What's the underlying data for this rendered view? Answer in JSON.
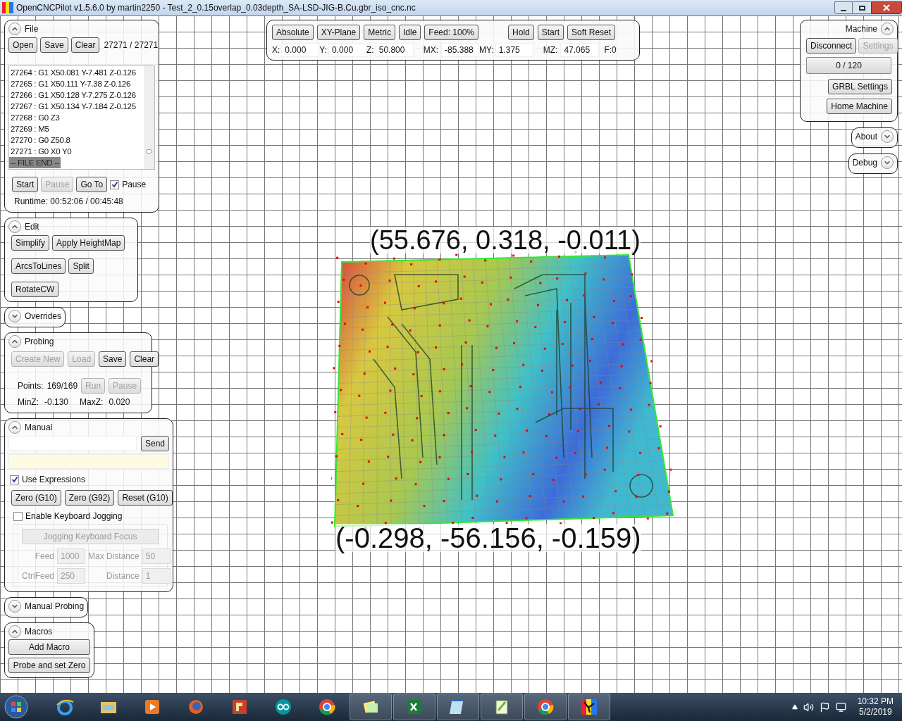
{
  "window": {
    "title": "OpenCNCPilot v1.5.6.0 by martin2250 - Test_2_0.15overlap_0.03depth_SA-LSD-JIG-B.Cu.gbr_iso_cnc.nc"
  },
  "file_panel": {
    "title": "File",
    "expanded": true,
    "buttons": [
      {
        "label": "Open",
        "disabled": false
      },
      {
        "label": "Save",
        "disabled": false
      },
      {
        "label": "Clear",
        "disabled": false
      }
    ],
    "progress": "27271 / 27271",
    "lines": [
      {
        "text": "27264 : G1 X50.081 Y-7.481 Z-0.126",
        "selected": false
      },
      {
        "text": "27265 : G1 X50.111 Y-7.38 Z-0.126",
        "selected": false
      },
      {
        "text": "27266 : G1 X50.128 Y-7.275 Z-0.126",
        "selected": false
      },
      {
        "text": "27267 : G1 X50.134 Y-7.184 Z-0.125",
        "selected": false
      },
      {
        "text": "27268 : G0 Z3",
        "selected": false
      },
      {
        "text": "27269 : M5",
        "selected": false
      },
      {
        "text": "27270 : G0 Z50.8",
        "selected": false
      },
      {
        "text": "27271 : G0 X0 Y0",
        "selected": false
      },
      {
        "text": "-- FILE END --",
        "selected": true
      }
    ],
    "controls": [
      {
        "kind": "button",
        "label": "Start",
        "disabled": false
      },
      {
        "kind": "button",
        "label": "Pause",
        "disabled": true
      },
      {
        "kind": "button",
        "label": "Go To",
        "disabled": false
      },
      {
        "kind": "checkbox",
        "label": "Pause",
        "checked": true
      }
    ],
    "runtime": "Runtime: 00:52:06 / 00:45:48"
  },
  "edit_panel": {
    "title": "Edit",
    "expanded": true,
    "button_rows": [
      [
        {
          "label": "Simplify",
          "disabled": false
        },
        {
          "label": "Apply HeightMap",
          "disabled": false
        }
      ],
      [
        {
          "label": "ArcsToLines",
          "disabled": false
        },
        {
          "label": "Split",
          "disabled": false
        }
      ],
      [
        {
          "label": "RotateCW",
          "disabled": false
        }
      ]
    ]
  },
  "overrides_panel": {
    "title": "Overrides",
    "expanded": false
  },
  "probing_panel": {
    "title": "Probing",
    "expanded": true,
    "buttons": [
      {
        "label": "Create New",
        "disabled": true
      },
      {
        "label": "Load",
        "disabled": true
      },
      {
        "label": "Save",
        "disabled": false
      },
      {
        "label": "Clear",
        "disabled": false
      }
    ],
    "points_label": "Points:",
    "points": "169/169",
    "run_buttons": [
      {
        "label": "Run",
        "disabled": true
      },
      {
        "label": "Pause",
        "disabled": true
      }
    ],
    "minz_label": "MinZ:",
    "minz": "-0.130",
    "maxz_label": "MaxZ:",
    "maxz": "0.020"
  },
  "manual_panel": {
    "title": "Manual",
    "expanded": true,
    "send": "Send",
    "use_expressions": {
      "label": "Use Expressions",
      "checked": true
    },
    "zero_buttons": [
      {
        "label": "Zero (G10)",
        "disabled": false
      },
      {
        "label": "Zero (G92)",
        "disabled": false
      },
      {
        "label": "Reset (G10)",
        "disabled": false
      }
    ],
    "keyboard_jogging": {
      "label": "Enable Keyboard Jogging",
      "checked": false
    },
    "focus_button": "Jogging Keyboard Focus",
    "jog_fields": [
      {
        "label": "Feed",
        "value": "1000"
      },
      {
        "label": "Max Distance",
        "value": "50"
      },
      {
        "label": "CtrlFeed",
        "value": "250"
      },
      {
        "label": "Distance",
        "value": "1"
      }
    ]
  },
  "manual_probing_panel": {
    "title": "Manual Probing",
    "expanded": false
  },
  "macros_panel": {
    "title": "Macros",
    "expanded": true,
    "buttons": [
      "Add Macro",
      "Probe and set Zero"
    ]
  },
  "status_toolbar": {
    "modes": [
      "Absolute",
      "XY-Plane",
      "Metric",
      "Idle",
      "Feed: 100%"
    ],
    "actions": [
      "Hold",
      "Start",
      "Soft Reset"
    ],
    "coords": [
      {
        "label": "X:",
        "value": "0.000"
      },
      {
        "label": "Y:",
        "value": "0.000"
      },
      {
        "label": "Z:",
        "value": "50.800"
      },
      {
        "label": "MX:",
        "value": "-85.388"
      },
      {
        "label": "MY:",
        "value": "1.375"
      },
      {
        "label": "MZ:",
        "value": "47.065"
      }
    ],
    "feed": "F:0"
  },
  "machine_panel": {
    "title": "Machine",
    "expanded": true,
    "buttons": [
      {
        "label": "Disconnect",
        "disabled": false
      },
      {
        "label": "Settings",
        "disabled": true
      }
    ],
    "buffer": "0 / 120",
    "grbl_settings": "GRBL Settings",
    "home": "Home Machine"
  },
  "about_panel": {
    "title": "About",
    "expanded": false
  },
  "debug_panel": {
    "title": "Debug",
    "expanded": false
  },
  "viewport": {
    "top_label": "(55.676, 0.318, -0.011)",
    "bottom_label": "(-0.298, -56.156, -0.159)"
  },
  "taskbar": {
    "apps": [
      {
        "kind": "ie",
        "running": false
      },
      {
        "kind": "folder",
        "running": false
      },
      {
        "kind": "media",
        "running": false
      },
      {
        "kind": "firefox",
        "running": false
      },
      {
        "kind": "r",
        "running": false
      },
      {
        "kind": "arduino",
        "running": false
      },
      {
        "kind": "chrome",
        "running": false
      },
      {
        "kind": "notes",
        "running": true
      },
      {
        "kind": "excel",
        "running": true
      },
      {
        "kind": "notepad",
        "running": true
      },
      {
        "kind": "notepadpp",
        "running": true
      },
      {
        "kind": "chrome",
        "running": true
      },
      {
        "kind": "cnc",
        "running": true
      }
    ],
    "time": "10:32 PM",
    "date": "5/2/2019"
  }
}
